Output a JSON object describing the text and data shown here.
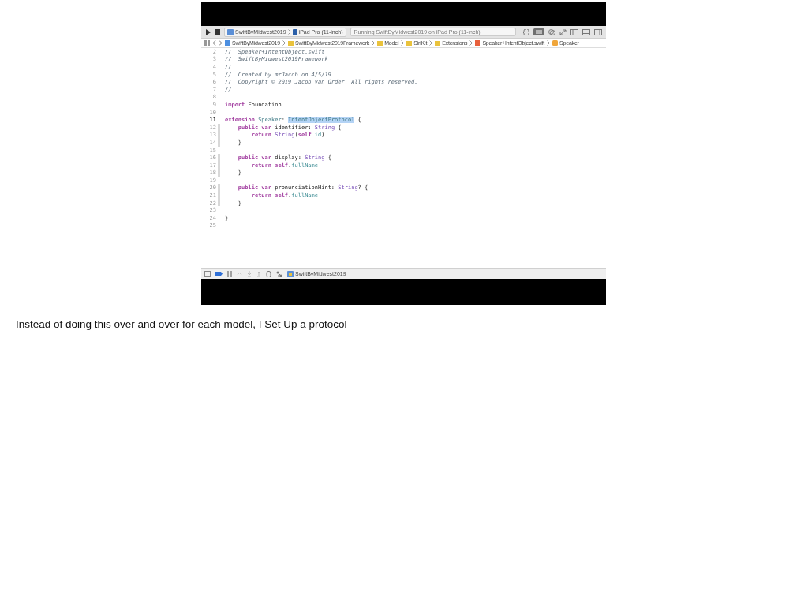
{
  "toolbar": {
    "scheme": "SwiftByMidwest2019",
    "device": "iPad Pro (11-inch)",
    "status": "Running SwiftByMidwest2019 on iPad Pro (11-inch)"
  },
  "breadcrumb": [
    {
      "label": "SwiftByMidwest2019",
      "kind": "project"
    },
    {
      "label": "SwiftByMidwest2019Framework",
      "kind": "folder"
    },
    {
      "label": "Model",
      "kind": "folder"
    },
    {
      "label": "SiriKit",
      "kind": "folder"
    },
    {
      "label": "Extensions",
      "kind": "folder"
    },
    {
      "label": "Speaker+IntentObject.swift",
      "kind": "file"
    },
    {
      "label": "Speaker",
      "kind": "symbol"
    }
  ],
  "code_lines": [
    {
      "number": "2",
      "current": false,
      "changed": false,
      "tokens": [
        {
          "text": "//  Speaker+IntentObject.swift",
          "kind": "comment"
        }
      ]
    },
    {
      "number": "3",
      "current": false,
      "changed": false,
      "tokens": [
        {
          "text": "//  SwiftByMidwest2019Framework",
          "kind": "comment"
        }
      ]
    },
    {
      "number": "4",
      "current": false,
      "changed": false,
      "tokens": [
        {
          "text": "//",
          "kind": "comment"
        }
      ]
    },
    {
      "number": "5",
      "current": false,
      "changed": false,
      "tokens": [
        {
          "text": "//  Created by mrJacob on 4/5/19.",
          "kind": "comment"
        }
      ]
    },
    {
      "number": "6",
      "current": false,
      "changed": false,
      "tokens": [
        {
          "text": "//  Copyright © 2019 Jacob Van Order. All rights reserved.",
          "kind": "comment"
        }
      ]
    },
    {
      "number": "7",
      "current": false,
      "changed": false,
      "tokens": [
        {
          "text": "//",
          "kind": "comment"
        }
      ]
    },
    {
      "number": "8",
      "current": false,
      "changed": false
    },
    {
      "number": "9",
      "current": false,
      "changed": false,
      "tokens": [
        {
          "text": "import",
          "kind": "keyword"
        },
        {
          "text": " Foundation",
          "kind": "plain"
        }
      ]
    },
    {
      "number": "10",
      "current": false,
      "changed": false
    },
    {
      "number": "11",
      "current": true,
      "changed": false,
      "tokens": [
        {
          "text": "extension",
          "kind": "keyword"
        },
        {
          "text": " Speaker",
          "kind": "project_type"
        },
        {
          "text": ": ",
          "kind": "plain"
        },
        {
          "text": "IntentObjectProtocol",
          "kind": "selection"
        },
        {
          "text": " {",
          "kind": "plain"
        }
      ]
    },
    {
      "number": "12",
      "current": false,
      "changed": true,
      "tokens": [
        {
          "text": "    public var",
          "kind": "keyword"
        },
        {
          "text": " identifier: ",
          "kind": "plain"
        },
        {
          "text": "String",
          "kind": "type"
        },
        {
          "text": " {",
          "kind": "plain"
        }
      ]
    },
    {
      "number": "13",
      "current": false,
      "changed": true,
      "tokens": [
        {
          "text": "        return ",
          "kind": "keyword"
        },
        {
          "text": "String",
          "kind": "type"
        },
        {
          "text": "(",
          "kind": "plain"
        },
        {
          "text": "self",
          "kind": "keyword"
        },
        {
          "text": ".",
          "kind": "plain"
        },
        {
          "text": "id",
          "kind": "property"
        },
        {
          "text": ")",
          "kind": "plain"
        }
      ]
    },
    {
      "number": "14",
      "current": false,
      "changed": true,
      "tokens": [
        {
          "text": "    }",
          "kind": "plain"
        }
      ]
    },
    {
      "number": "15",
      "current": false,
      "changed": false
    },
    {
      "number": "16",
      "current": false,
      "changed": true,
      "tokens": [
        {
          "text": "    public var",
          "kind": "keyword"
        },
        {
          "text": " display: ",
          "kind": "plain"
        },
        {
          "text": "String",
          "kind": "type"
        },
        {
          "text": " {",
          "kind": "plain"
        }
      ]
    },
    {
      "number": "17",
      "current": false,
      "changed": true,
      "tokens": [
        {
          "text": "        return self",
          "kind": "keyword"
        },
        {
          "text": ".",
          "kind": "plain"
        },
        {
          "text": "fullName",
          "kind": "property"
        }
      ]
    },
    {
      "number": "18",
      "current": false,
      "changed": true,
      "tokens": [
        {
          "text": "    }",
          "kind": "plain"
        }
      ]
    },
    {
      "number": "19",
      "current": false,
      "changed": false
    },
    {
      "number": "20",
      "current": false,
      "changed": true,
      "tokens": [
        {
          "text": "    public var",
          "kind": "keyword"
        },
        {
          "text": " pronunciationHint: ",
          "kind": "plain"
        },
        {
          "text": "String",
          "kind": "type"
        },
        {
          "text": "? {",
          "kind": "plain"
        }
      ]
    },
    {
      "number": "21",
      "current": false,
      "changed": true,
      "tokens": [
        {
          "text": "        return self",
          "kind": "keyword"
        },
        {
          "text": ".",
          "kind": "plain"
        },
        {
          "text": "fullName",
          "kind": "property"
        }
      ]
    },
    {
      "number": "22",
      "current": false,
      "changed": true,
      "tokens": [
        {
          "text": "    }",
          "kind": "plain"
        }
      ]
    },
    {
      "number": "23",
      "current": false,
      "changed": false
    },
    {
      "number": "24",
      "current": false,
      "changed": false,
      "tokens": [
        {
          "text": "}",
          "kind": "plain"
        }
      ]
    },
    {
      "number": "25",
      "current": false,
      "changed": false
    }
  ],
  "debug_bar": {
    "target": "SwiftByMidwest2019"
  },
  "notes": "Instead of doing this over and over for each model, I Set Up a protocol"
}
